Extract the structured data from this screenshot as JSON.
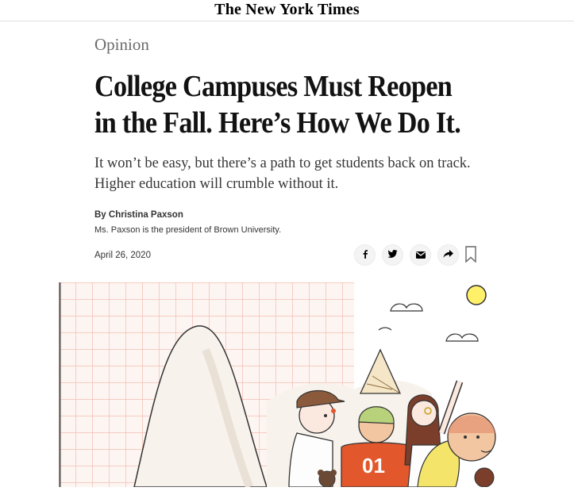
{
  "masthead": {
    "logo_text": "The New York Times"
  },
  "article": {
    "section": "Opinion",
    "headline": "College Campuses Must Reopen in the Fall. Here’s How We Do It.",
    "summary": "It won’t be easy, but there’s a path to get students back on track. Higher education will crumble without it.",
    "byline": "By Christina Paxson",
    "author_bio": "Ms. Paxson is the president of Brown University.",
    "date": "April 26, 2020"
  },
  "share_tools": {
    "icons": [
      "facebook-icon",
      "twitter-icon",
      "email-icon",
      "share-icon",
      "bookmark-icon"
    ]
  },
  "illustration": {
    "jersey_number": "01",
    "colors": {
      "grid": "#f2b3a6",
      "accent_orange": "#e2572b",
      "sun": "#fff06a"
    }
  }
}
